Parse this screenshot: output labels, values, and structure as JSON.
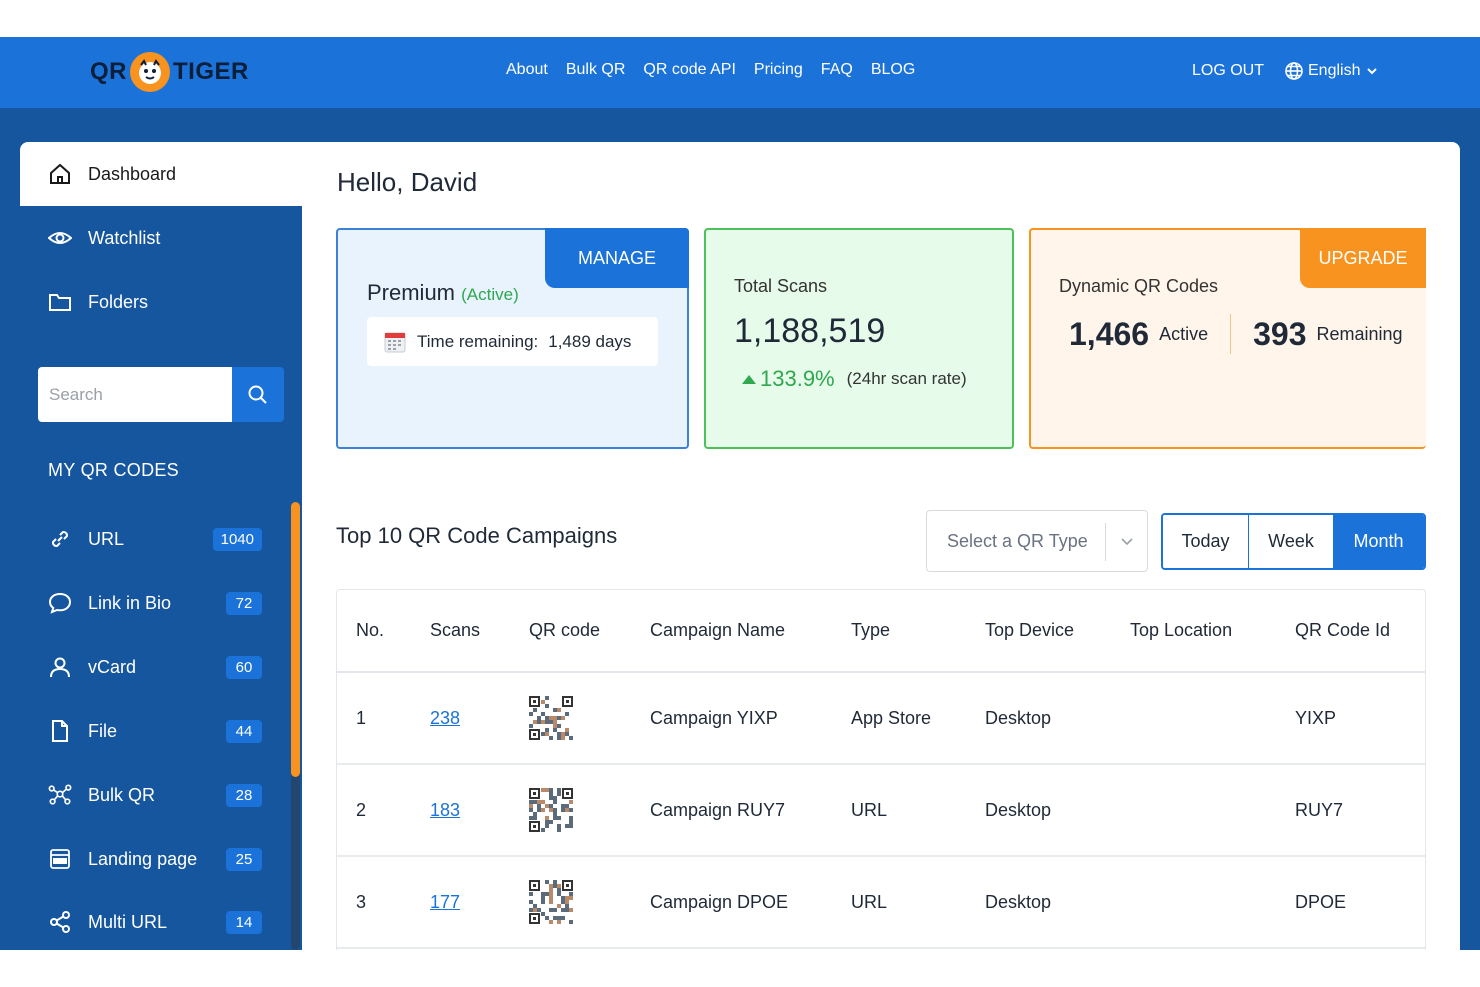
{
  "nav": {
    "logo_left": "QR",
    "logo_right": "TIGER",
    "links": [
      "About",
      "Bulk QR",
      "QR code API",
      "Pricing",
      "FAQ",
      "BLOG"
    ],
    "logout": "LOG OUT",
    "language": "English"
  },
  "sidebar": {
    "items": [
      {
        "label": "Dashboard",
        "icon": "home-icon"
      },
      {
        "label": "Watchlist",
        "icon": "eye-icon"
      },
      {
        "label": "Folders",
        "icon": "folder-icon"
      }
    ],
    "search_placeholder": "Search",
    "section_title": "MY QR CODES",
    "qr_types": [
      {
        "label": "URL",
        "count": "1040",
        "icon": "link-icon"
      },
      {
        "label": "Link in Bio",
        "count": "72",
        "icon": "chat-bubble-icon"
      },
      {
        "label": "vCard",
        "count": "60",
        "icon": "user-icon"
      },
      {
        "label": "File",
        "count": "44",
        "icon": "file-icon"
      },
      {
        "label": "Bulk QR",
        "count": "28",
        "icon": "nodes-icon"
      },
      {
        "label": "Landing page",
        "count": "25",
        "icon": "html-page-icon"
      },
      {
        "label": "Multi URL",
        "count": "14",
        "icon": "share-icon"
      }
    ]
  },
  "main": {
    "greeting": "Hello, David",
    "premium": {
      "manage_label": "MANAGE",
      "plan": "Premium",
      "status": "(Active)",
      "time_label": "Time remaining:",
      "time_value": "1,489 days"
    },
    "scans": {
      "title": "Total Scans",
      "total": "1,188,519",
      "growth": "133.9%",
      "growth_note": "(24hr scan rate)"
    },
    "dynamic": {
      "upgrade_label": "UPGRADE",
      "title": "Dynamic QR Codes",
      "active_count": "1,466",
      "active_label": "Active",
      "remaining_count": "393",
      "remaining_label": "Remaining"
    },
    "campaigns": {
      "title": "Top 10 QR Code Campaigns",
      "select_placeholder": "Select a QR Type",
      "ranges": [
        "Today",
        "Week",
        "Month"
      ],
      "selected_range": "Month",
      "columns": [
        "No.",
        "Scans",
        "QR code",
        "Campaign Name",
        "Type",
        "Top Device",
        "Top Location",
        "QR Code Id"
      ],
      "rows": [
        {
          "no": "1",
          "scans": "238",
          "name": "Campaign YIXP",
          "type": "App Store",
          "device": "Desktop",
          "location": "",
          "id": "YIXP"
        },
        {
          "no": "2",
          "scans": "183",
          "name": "Campaign RUY7",
          "type": "URL",
          "device": "Desktop",
          "location": "",
          "id": "RUY7"
        },
        {
          "no": "3",
          "scans": "177",
          "name": "Campaign DPOE",
          "type": "URL",
          "device": "Desktop",
          "location": "",
          "id": "DPOE"
        }
      ]
    }
  },
  "colors": {
    "primary": "#1b73d9",
    "sidebar": "#16569e",
    "success": "#2fa84f",
    "accent": "#f7931e"
  }
}
